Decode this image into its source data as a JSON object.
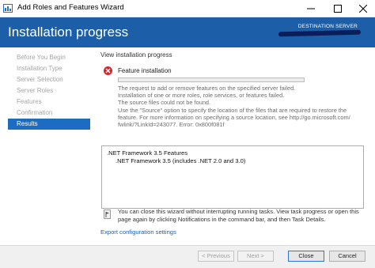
{
  "window": {
    "title": "Add Roles and Features Wizard"
  },
  "header": {
    "page_title": "Installation progress",
    "destination_label": "DESTINATION SERVER"
  },
  "nav": {
    "items": [
      {
        "label": "Before You Begin",
        "active": false
      },
      {
        "label": "Installation Type",
        "active": false
      },
      {
        "label": "Server Selection",
        "active": false
      },
      {
        "label": "Server Roles",
        "active": false
      },
      {
        "label": "Features",
        "active": false
      },
      {
        "label": "Confirmation",
        "active": false
      },
      {
        "label": "Results",
        "active": true
      }
    ]
  },
  "main": {
    "section_title": "View installation progress",
    "feature_status_icon": "error-icon",
    "feature_label": "Feature installation",
    "progress_percent": 0,
    "error_lines": [
      "The request to add or remove features on the specified server failed.",
      "Installation of one or more roles, role services, or features failed.",
      "The source files could not be found.",
      "Use the \"Source\" option to specify the location of the files that are required to restore the",
      "feature. For more information on specifying a source location, see http://go.microsoft.com/",
      "fwlink/?LinkId=243077. Error: 0x800f081f"
    ],
    "results": {
      "title": ".NET Framework 3.5 Features",
      "subitem": ".NET Framework 3.5 (includes .NET 2.0 and 3.0)"
    },
    "info_lines": [
      "You can close this wizard without interrupting running tasks. View task progress or open this",
      "page again by clicking Notifications in the command bar, and then Task Details."
    ],
    "export_link": "Export configuration settings"
  },
  "footer": {
    "previous": "< Previous",
    "next": "Next >",
    "close": "Close",
    "cancel": "Cancel"
  },
  "colors": {
    "header_bg": "#1c5fa8",
    "nav_active": "#1c6dc2",
    "error": "#d9262e",
    "link": "#1560c0"
  }
}
